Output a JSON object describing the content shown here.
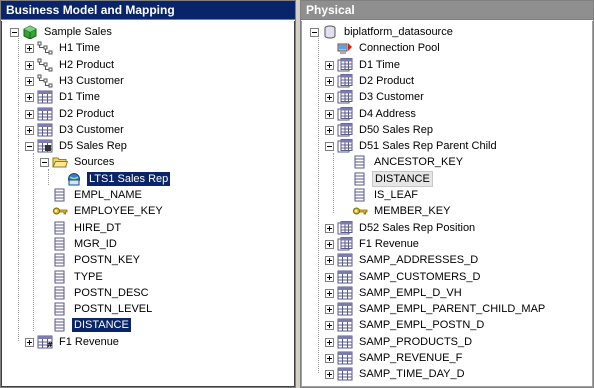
{
  "left_panel": {
    "title": "Business Model and Mapping",
    "root": "Sample Sales",
    "items": [
      {
        "label": "H1 Time",
        "icon": "hierarchy-icon",
        "expander": "plus"
      },
      {
        "label": "H2 Product",
        "icon": "hierarchy-icon",
        "expander": "plus"
      },
      {
        "label": "H3 Customer",
        "icon": "hierarchy-icon",
        "expander": "plus"
      },
      {
        "label": "D1 Time",
        "icon": "logical-table-icon",
        "expander": "plus"
      },
      {
        "label": "D2 Product",
        "icon": "logical-table-icon",
        "expander": "plus"
      },
      {
        "label": "D3 Customer",
        "icon": "logical-table-icon",
        "expander": "plus"
      },
      {
        "label": "D5 Sales Rep",
        "icon": "logical-table-key-icon",
        "expander": "minus"
      },
      {
        "label": "Sources",
        "icon": "folder-open-icon",
        "expander": "minus"
      },
      {
        "label": "LTS1 Sales Rep",
        "icon": "table-source-icon",
        "expander": "none"
      },
      {
        "label": "EMPL_NAME",
        "icon": "column-icon",
        "expander": "none"
      },
      {
        "label": "EMPLOYEE_KEY",
        "icon": "key-icon",
        "expander": "none"
      },
      {
        "label": "HIRE_DT",
        "icon": "column-icon",
        "expander": "none"
      },
      {
        "label": "MGR_ID",
        "icon": "column-icon",
        "expander": "none"
      },
      {
        "label": "POSTN_KEY",
        "icon": "column-icon",
        "expander": "none"
      },
      {
        "label": "TYPE",
        "icon": "column-icon",
        "expander": "none"
      },
      {
        "label": "POSTN_DESC",
        "icon": "column-icon",
        "expander": "none"
      },
      {
        "label": "POSTN_LEVEL",
        "icon": "column-icon",
        "expander": "none"
      },
      {
        "label": "DISTANCE",
        "icon": "column-icon",
        "expander": "none"
      },
      {
        "label": "F1 Revenue",
        "icon": "fact-table-icon",
        "expander": "plus"
      }
    ]
  },
  "right_panel": {
    "title": "Physical",
    "root": "biplatform_datasource",
    "items": [
      {
        "label": "Connection Pool",
        "icon": "connection-pool-icon",
        "expander": "none"
      },
      {
        "label": "D1 Time",
        "icon": "alias-table-icon",
        "expander": "plus"
      },
      {
        "label": "D2 Product",
        "icon": "alias-table-icon",
        "expander": "plus"
      },
      {
        "label": "D3 Customer",
        "icon": "alias-table-icon",
        "expander": "plus"
      },
      {
        "label": "D4 Address",
        "icon": "alias-table-icon",
        "expander": "plus"
      },
      {
        "label": "D50 Sales Rep",
        "icon": "alias-table-icon",
        "expander": "plus"
      },
      {
        "label": "D51 Sales Rep Parent Child",
        "icon": "alias-table-icon",
        "expander": "minus"
      },
      {
        "label": "ANCESTOR_KEY",
        "icon": "column-icon",
        "expander": "none"
      },
      {
        "label": "DISTANCE",
        "icon": "column-icon",
        "expander": "none"
      },
      {
        "label": "IS_LEAF",
        "icon": "column-icon",
        "expander": "none"
      },
      {
        "label": "MEMBER_KEY",
        "icon": "key-icon",
        "expander": "none"
      },
      {
        "label": "D52 Sales Rep Position",
        "icon": "alias-table-icon",
        "expander": "plus"
      },
      {
        "label": "F1 Revenue",
        "icon": "alias-table-icon",
        "expander": "plus"
      },
      {
        "label": "SAMP_ADDRESSES_D",
        "icon": "physical-table-icon",
        "expander": "plus"
      },
      {
        "label": "SAMP_CUSTOMERS_D",
        "icon": "physical-table-icon",
        "expander": "plus"
      },
      {
        "label": "SAMP_EMPL_D_VH",
        "icon": "physical-table-icon",
        "expander": "plus"
      },
      {
        "label": "SAMP_EMPL_PARENT_CHILD_MAP",
        "icon": "physical-table-icon",
        "expander": "plus"
      },
      {
        "label": "SAMP_EMPL_POSTN_D",
        "icon": "physical-table-icon",
        "expander": "plus"
      },
      {
        "label": "SAMP_PRODUCTS_D",
        "icon": "physical-table-icon",
        "expander": "plus"
      },
      {
        "label": "SAMP_REVENUE_F",
        "icon": "physical-table-icon",
        "expander": "plus"
      },
      {
        "label": "SAMP_TIME_DAY_D",
        "icon": "physical-table-icon",
        "expander": "plus"
      }
    ]
  }
}
